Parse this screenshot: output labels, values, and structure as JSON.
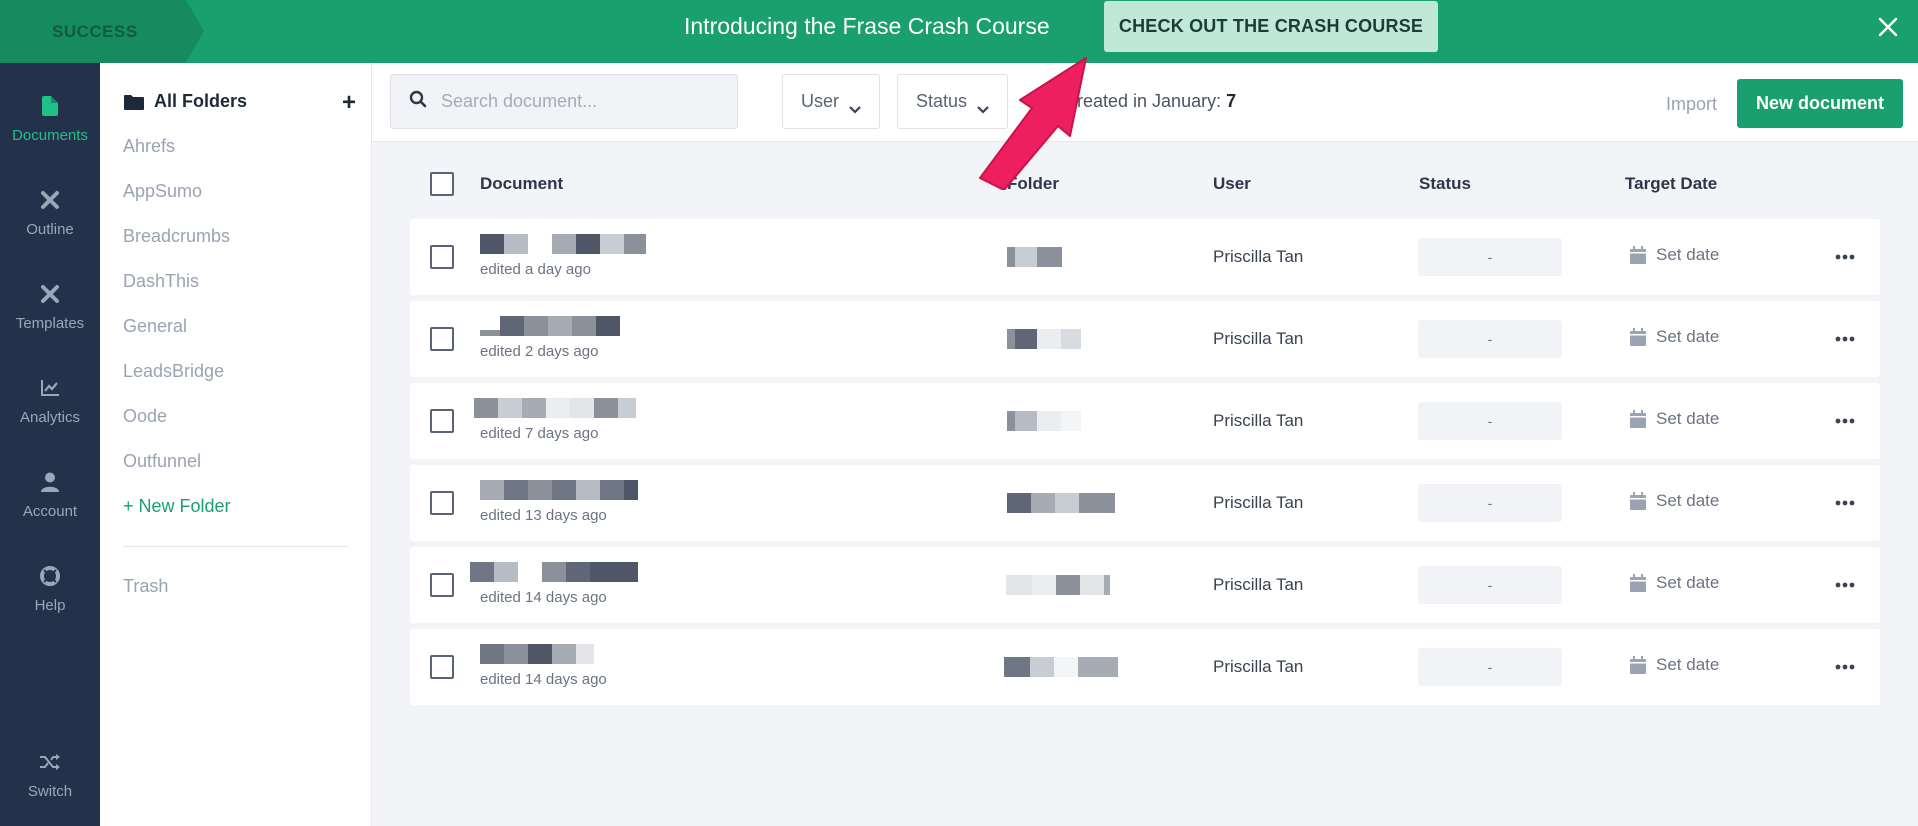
{
  "banner": {
    "tag": "SUCCESS",
    "text": "Introducing the Frase Crash Course",
    "cta": "CHECK OUT THE CRASH COURSE",
    "close_icon": "close-icon"
  },
  "nav": {
    "items": [
      {
        "label": "Documents",
        "icon": "document-icon",
        "active": true
      },
      {
        "label": "Outline",
        "icon": "tools-icon"
      },
      {
        "label": "Templates",
        "icon": "tools-icon"
      },
      {
        "label": "Analytics",
        "icon": "chart-line-icon"
      },
      {
        "label": "Account",
        "icon": "user-icon"
      },
      {
        "label": "Help",
        "icon": "lifebuoy-icon"
      },
      {
        "label": "Switch",
        "icon": "shuffle-icon"
      }
    ]
  },
  "folders": {
    "title": "All Folders",
    "add_label": "+",
    "items": [
      "Ahrefs",
      "AppSumo",
      "Breadcrumbs",
      "DashThis",
      "General",
      "LeadsBridge",
      "Oode",
      "Outfunnel"
    ],
    "new_folder": "+ New Folder",
    "trash": "Trash"
  },
  "toolbar": {
    "search_placeholder": "Search document...",
    "user_filter": "User",
    "status_filter": "Status",
    "created_prefix": "s created in January:",
    "created_count": "7",
    "import": "Import",
    "new_document": "New document"
  },
  "table": {
    "headers": {
      "document": "Document",
      "folder": "Folder",
      "user": "User",
      "status": "Status",
      "target_date": "Target Date"
    },
    "rows": [
      {
        "edited": "edited a day ago",
        "user": "Priscilla Tan",
        "status": "-",
        "date": "Set date"
      },
      {
        "edited": "edited 2 days ago",
        "user": "Priscilla Tan",
        "status": "-",
        "date": "Set date"
      },
      {
        "edited": "edited 7 days ago",
        "user": "Priscilla Tan",
        "status": "-",
        "date": "Set date"
      },
      {
        "edited": "edited 13 days ago",
        "user": "Priscilla Tan",
        "status": "-",
        "date": "Set date"
      },
      {
        "edited": "edited 14 days ago",
        "user": "Priscilla Tan",
        "status": "-",
        "date": "Set date"
      },
      {
        "edited": "edited 14 days ago",
        "user": "Priscilla Tan",
        "status": "-",
        "date": "Set date"
      }
    ]
  },
  "colors": {
    "brand_green": "#19a06e",
    "nav_bg": "#23324a",
    "arrow": "#ee1f5f"
  }
}
